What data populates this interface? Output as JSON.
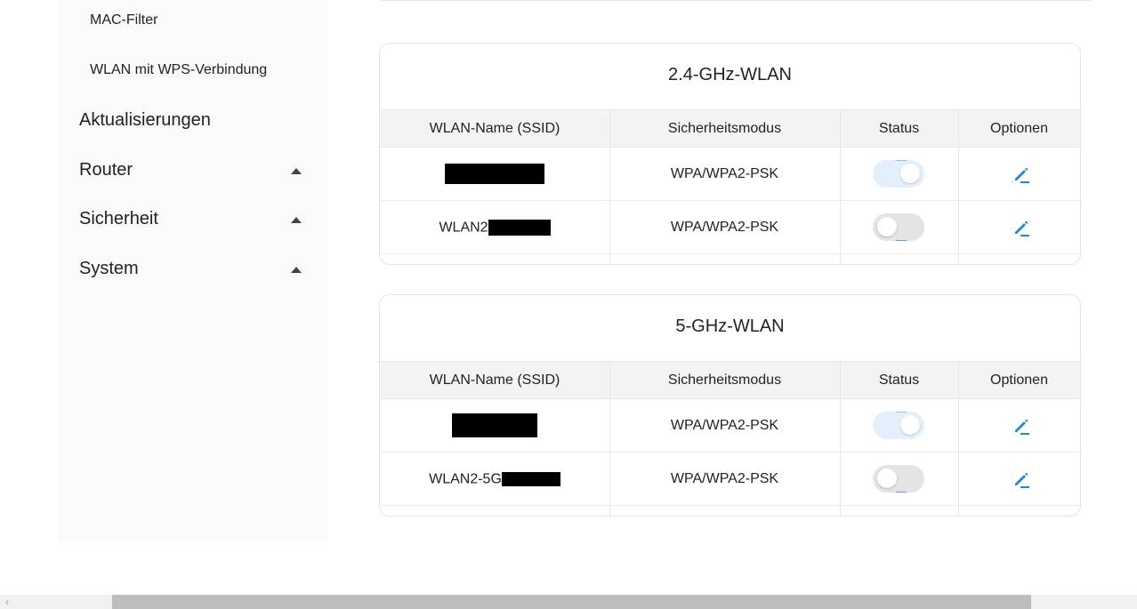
{
  "sidebar": {
    "sub_items": [
      {
        "label": "MAC-Filter"
      },
      {
        "label": "WLAN mit WPS-Verbindung"
      }
    ],
    "main_items": [
      {
        "label": "Aktualisierungen",
        "expandable": false
      },
      {
        "label": "Router",
        "expandable": true
      },
      {
        "label": "Sicherheit",
        "expandable": true
      },
      {
        "label": "System",
        "expandable": true
      }
    ]
  },
  "columns": {
    "ssid": "WLAN-Name (SSID)",
    "security": "Sicherheitsmodus",
    "status": "Status",
    "options": "Optionen"
  },
  "cards": [
    {
      "title": "2.4-GHz-WLAN",
      "rows": [
        {
          "ssid": "",
          "ssid_redacted": true,
          "security": "WPA/WPA2-PSK",
          "enabled": true
        },
        {
          "ssid": "WLAN2",
          "ssid_redacted": true,
          "security": "WPA/WPA2-PSK",
          "enabled": false
        }
      ]
    },
    {
      "title": "5-GHz-WLAN",
      "rows": [
        {
          "ssid": "",
          "ssid_redacted": true,
          "security": "WPA/WPA2-PSK",
          "enabled": true
        },
        {
          "ssid": "WLAN2-5G",
          "ssid_redacted": true,
          "security": "WPA/WPA2-PSK",
          "enabled": false
        }
      ]
    }
  ],
  "icons": {
    "edit": "pencil-edit-icon",
    "caret": "caret-up-icon",
    "scroll_left": "scroll-left-arrow-icon"
  },
  "colors": {
    "accent": "#1e88e5",
    "toggle_on_track": "#e3f0fc",
    "toggle_off_track": "#e4e4e4"
  }
}
